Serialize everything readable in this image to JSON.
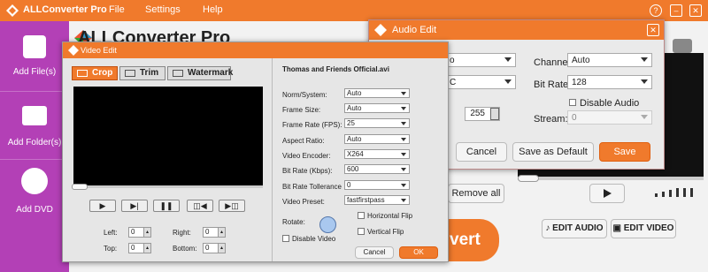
{
  "app": {
    "title": "ALLConverter Pro",
    "brand": "ALLConverter Pro",
    "menu": [
      "File",
      "Settings",
      "Help"
    ],
    "accent_color": "#f07a2c",
    "sidebar_color": "#b340b6"
  },
  "sidebar": {
    "items": [
      {
        "label": "Add File(s)",
        "icon": "film-icon"
      },
      {
        "label": "Add Folder(s)",
        "icon": "folder-icon"
      },
      {
        "label": "Add DVD",
        "icon": "disc-icon"
      }
    ]
  },
  "main": {
    "remove_all_label": "Remove all",
    "convert_label": "vert",
    "edit_audio_label": "EDIT AUDIO",
    "edit_video_label": "EDIT VIDEO"
  },
  "audio_edit": {
    "title": "Audio Edit",
    "channel_label": "Channel:",
    "channel_value": "Auto",
    "bitrate_label": "Bit Rate:",
    "bitrate_value": "128",
    "disable_audio_label": "Disable Audio",
    "stream_label": "Stream:",
    "stream_value": "0",
    "volume_value": "255",
    "left_select1_value": "o",
    "left_select2_value": "C",
    "cancel_label": "Cancel",
    "save_default_label": "Save as Default",
    "save_label": "Save"
  },
  "video_edit": {
    "title": "Video Edit",
    "tabs": [
      "Crop",
      "Trim",
      "Watermark"
    ],
    "filename": "Thomas and Friends Official.avi",
    "fields": [
      {
        "label": "Norm/System:",
        "value": "Auto"
      },
      {
        "label": "Frame Size:",
        "value": "Auto"
      },
      {
        "label": "Frame Rate (FPS):",
        "value": "25"
      },
      {
        "label": "Aspect Ratio:",
        "value": "Auto"
      },
      {
        "label": "Video Encoder:",
        "value": "X264"
      },
      {
        "label": "Bit Rate (Kbps):",
        "value": "600"
      },
      {
        "label": "Bit Rate Tollerance",
        "value": "0"
      },
      {
        "label": "Video Preset:",
        "value": "fastfirstpass"
      }
    ],
    "rotate_label": "Rotate:",
    "horizontal_flip_label": "Horizontal Flip",
    "vertical_flip_label": "Vertical Flip",
    "disable_video_label": "Disable Video",
    "crop": {
      "left_label": "Left:",
      "left_value": "0",
      "right_label": "Right:",
      "right_value": "0",
      "top_label": "Top:",
      "top_value": "0",
      "bottom_label": "Bottom:",
      "bottom_value": "0"
    },
    "cancel_label": "Cancel",
    "ok_label": "OK"
  }
}
